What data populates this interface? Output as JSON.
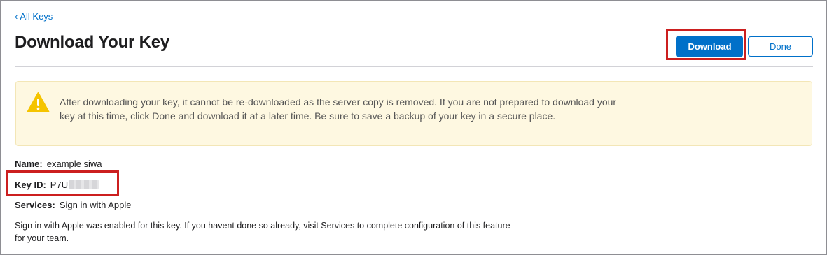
{
  "nav": {
    "back_label": "All Keys"
  },
  "header": {
    "title": "Download Your Key",
    "download_label": "Download",
    "done_label": "Done"
  },
  "warning": {
    "icon": "warning-triangle-icon",
    "text": "After downloading your key, it cannot be re-downloaded as the server copy is removed. If you are not prepared to download your key at this time, click Done and download it at a later time. Be sure to save a backup of your key in a secure place."
  },
  "details": {
    "name_label": "Name:",
    "name_value": "example siwa",
    "key_id_label": "Key ID:",
    "key_id_value": "P7U",
    "services_label": "Services:",
    "services_value": "Sign in with Apple"
  },
  "note": "Sign in with Apple was enabled for this key. If you havent done so already, visit Services to complete configuration of this feature for your team.",
  "colors": {
    "accent": "#0070c9",
    "highlight": "#cc1f1f",
    "warning_bg": "#fef8e1",
    "warning_icon": "#f5c400"
  }
}
